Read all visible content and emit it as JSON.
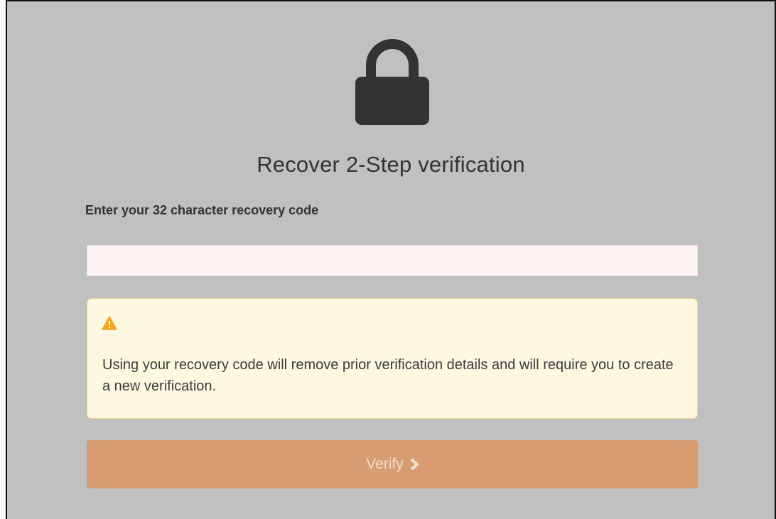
{
  "page": {
    "title": "Recover 2-Step verification",
    "lock_icon": "lock-icon"
  },
  "form": {
    "code_label": "Enter your 32 character recovery code",
    "code_value": "",
    "code_placeholder": ""
  },
  "warning": {
    "icon": "warning-triangle-icon",
    "icon_color": "#f5a623",
    "message": "Using your recovery code will remove prior verification details and will require you to create a new verification."
  },
  "actions": {
    "verify_label": "Verify",
    "verify_icon": "chevron-right-icon",
    "verify_color": "#d89c72"
  },
  "colors": {
    "background": "#c0c0c0",
    "text": "#333333",
    "warning_bg": "#fff8e1",
    "warning_border": "#ecd58c"
  }
}
